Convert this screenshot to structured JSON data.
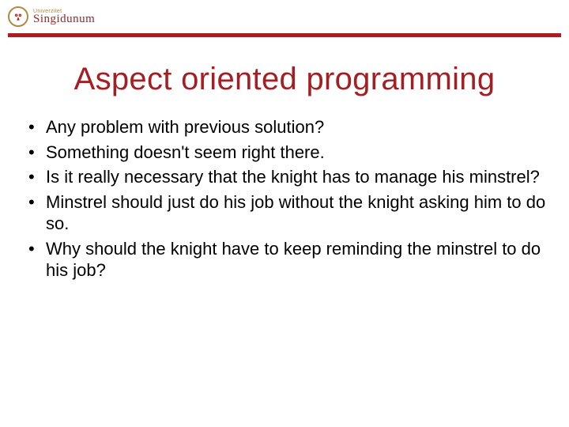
{
  "brand": {
    "small_label": "Univerzitet",
    "name": "Singidunum"
  },
  "title": "Aspect oriented programming",
  "bullets": [
    "Any problem with previous solution?",
    "Something doesn't seem right there.",
    "Is it really necessary that the knight has to manage his minstrel?",
    "Minstrel should just do his job without the knight asking him to do so.",
    "Why should the knight have to keep reminding the minstrel to do his job?"
  ]
}
